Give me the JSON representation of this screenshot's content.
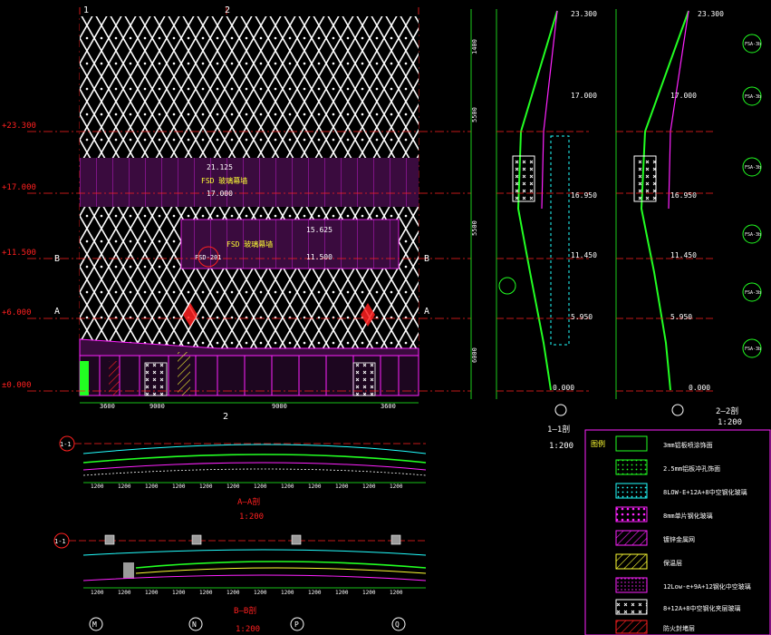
{
  "colors": {
    "background": "#000000",
    "red": "#ff2020",
    "green": "#22ff22",
    "cyan": "#22ffff",
    "yellow": "#ffff33",
    "magenta": "#ff22ff",
    "white": "#ffffff"
  },
  "elevation": {
    "grid_top": [
      "1",
      "2"
    ],
    "grid_bottom": "2",
    "levels": [
      {
        "label": "+23.300"
      },
      {
        "label": "+17.000"
      },
      {
        "label": "+11.500"
      },
      {
        "label": "+6.000"
      },
      {
        "label": "±0.000"
      }
    ],
    "axis_marks": [
      "B",
      "A"
    ],
    "band_texts": [
      "21.125",
      "FSD 玻璃幕墙",
      "17.000",
      "15.625",
      "FSD 玻璃幕墙",
      "11.500"
    ],
    "callout": "FSD-201",
    "bottom_dims": [
      "3600",
      "9000",
      "9000",
      "3600"
    ]
  },
  "section_views": {
    "left_title": "1—1剖",
    "left_scale": "1:200",
    "right_title": "2—2剖",
    "right_scale": "1:200",
    "left_levels": [
      "23.300",
      "17.000",
      "16.950",
      "11.450",
      "5.950",
      "0.000"
    ],
    "right_levels": [
      "23.300",
      "17.000",
      "16.950",
      "11.450",
      "5.950",
      "0.000"
    ],
    "tags": [
      "FSA-3b",
      "FSA-3b",
      "FSA-3b",
      "FSA-3b",
      "FSA-3b",
      "FSA-3b"
    ]
  },
  "plan_views": {
    "top_title": "A—A剖",
    "top_scale": "1:200",
    "bottom_title": "B—B剖",
    "bottom_scale": "1:200",
    "top_axis": "1-1",
    "bottom_axis": "1-1",
    "bottom_axes": [
      "M",
      "N",
      "P",
      "Q"
    ]
  },
  "legend": {
    "header": "图例",
    "items": [
      {
        "label": "3mm铝板喷涂饰面",
        "pattern": "plain",
        "color": "#22ff22"
      },
      {
        "label": "2.5mm铝板冲孔饰面",
        "pattern": "dots-green",
        "color": "#22ff22"
      },
      {
        "label": "8LOW-E+12A+8中空钢化玻璃",
        "pattern": "dots-cyan",
        "color": "#22ffff"
      },
      {
        "label": "8mm单片钢化玻璃",
        "pattern": "dots-magenta",
        "color": "#ff22ff"
      },
      {
        "label": "镀锌金属网",
        "pattern": "hatch-magenta",
        "color": "#ff22ff"
      },
      {
        "label": "保温层",
        "pattern": "hatch-yellow",
        "color": "#ffff33"
      },
      {
        "label": "12Low-e+9A+12钢化中空玻璃",
        "pattern": "dots-small",
        "color": "#ff22ff"
      },
      {
        "label": "8+12A+8中空钢化夹层玻璃",
        "pattern": "cross-white",
        "color": "#ffffff"
      },
      {
        "label": "防火封堵层",
        "pattern": "hatch-red",
        "color": "#ff2020"
      }
    ]
  }
}
